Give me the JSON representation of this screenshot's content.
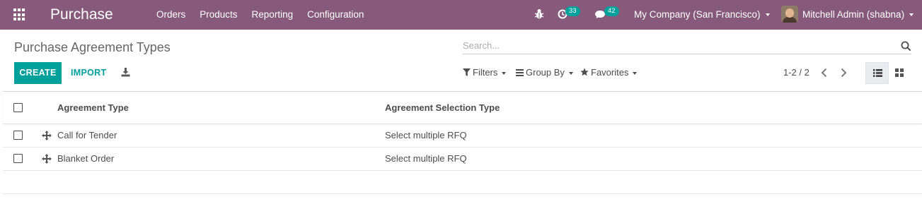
{
  "navbar": {
    "app_title": "Purchase",
    "menu": [
      "Orders",
      "Products",
      "Reporting",
      "Configuration"
    ],
    "activity_count": "33",
    "message_count": "42",
    "company": "My Company (San Francisco)",
    "user": "Mitchell Admin (shabna)",
    "brand_color": "#875a7b"
  },
  "control_panel": {
    "breadcrumb": "Purchase Agreement Types",
    "search_placeholder": "Search...",
    "create_label": "CREATE",
    "import_label": "IMPORT",
    "filters_label": "Filters",
    "groupby_label": "Group By",
    "favorites_label": "Favorites",
    "pager": "1-2 / 2",
    "accent_color": "#00a09d"
  },
  "table": {
    "columns": [
      "Agreement Type",
      "Agreement Selection Type"
    ],
    "rows": [
      {
        "type": "Call for Tender",
        "selection": "Select multiple RFQ"
      },
      {
        "type": "Blanket Order",
        "selection": "Select multiple RFQ"
      }
    ]
  },
  "icons": [
    "apps-icon",
    "bug-icon",
    "activity-clock-icon",
    "chat-icon",
    "search-icon",
    "download-icon",
    "filter-icon",
    "group-by-icon",
    "star-icon",
    "chevron-left-icon",
    "chevron-right-icon",
    "list-view-icon",
    "kanban-view-icon",
    "drag-handle-icon"
  ]
}
